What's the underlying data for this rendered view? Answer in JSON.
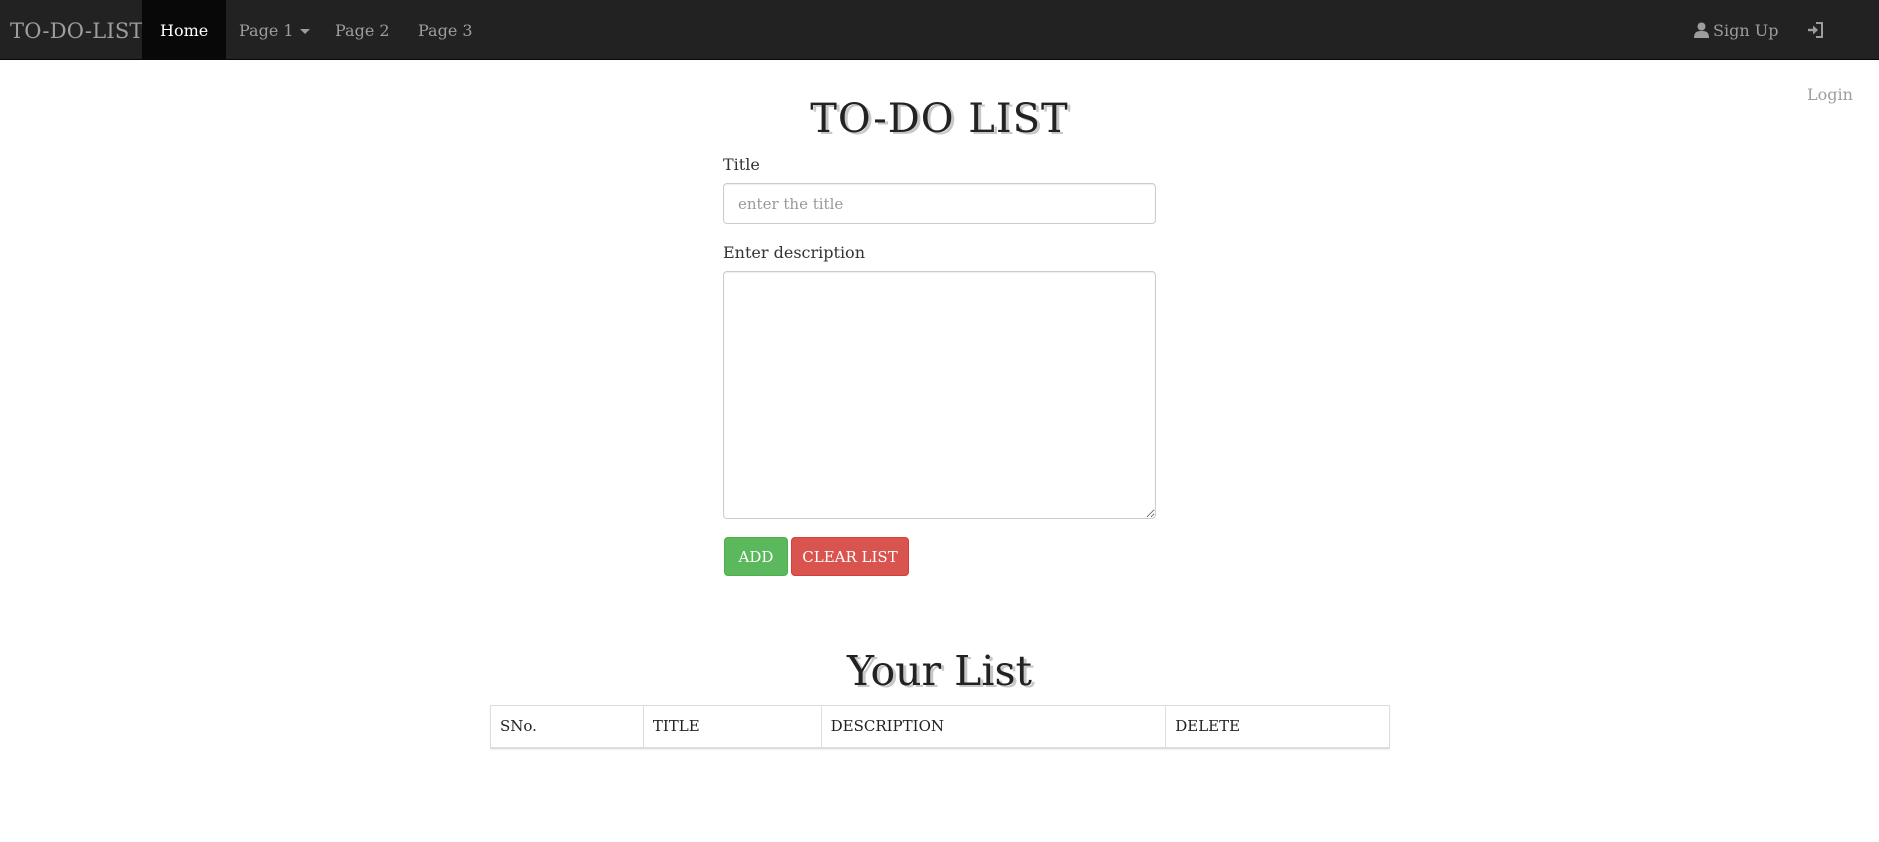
{
  "navbar": {
    "brand": "TO-DO-LIST",
    "items": [
      {
        "label": "Home",
        "active": true
      },
      {
        "label": "Page 1",
        "has_dropdown": true
      },
      {
        "label": "Page 2"
      },
      {
        "label": "Page 3"
      }
    ],
    "right_items": [
      {
        "label": "Sign Up",
        "icon": "user-icon"
      },
      {
        "label": "Login",
        "icon": "login-icon"
      }
    ]
  },
  "form": {
    "heading": "TO-DO LIST",
    "title_label": "Title",
    "title_placeholder": "enter the title",
    "title_value": "",
    "description_label": "Enter description",
    "description_value": "",
    "add_button": "ADD",
    "clear_button": "CLEAR LIST"
  },
  "list": {
    "heading": "Your List",
    "columns": [
      "SNo.",
      "TITLE",
      "DESCRIPTION",
      "DELETE"
    ],
    "rows": []
  },
  "colors": {
    "navbar_bg": "#222222",
    "navbar_active_bg": "#080808",
    "add_button": "#5cb85c",
    "clear_button": "#d9534f"
  }
}
